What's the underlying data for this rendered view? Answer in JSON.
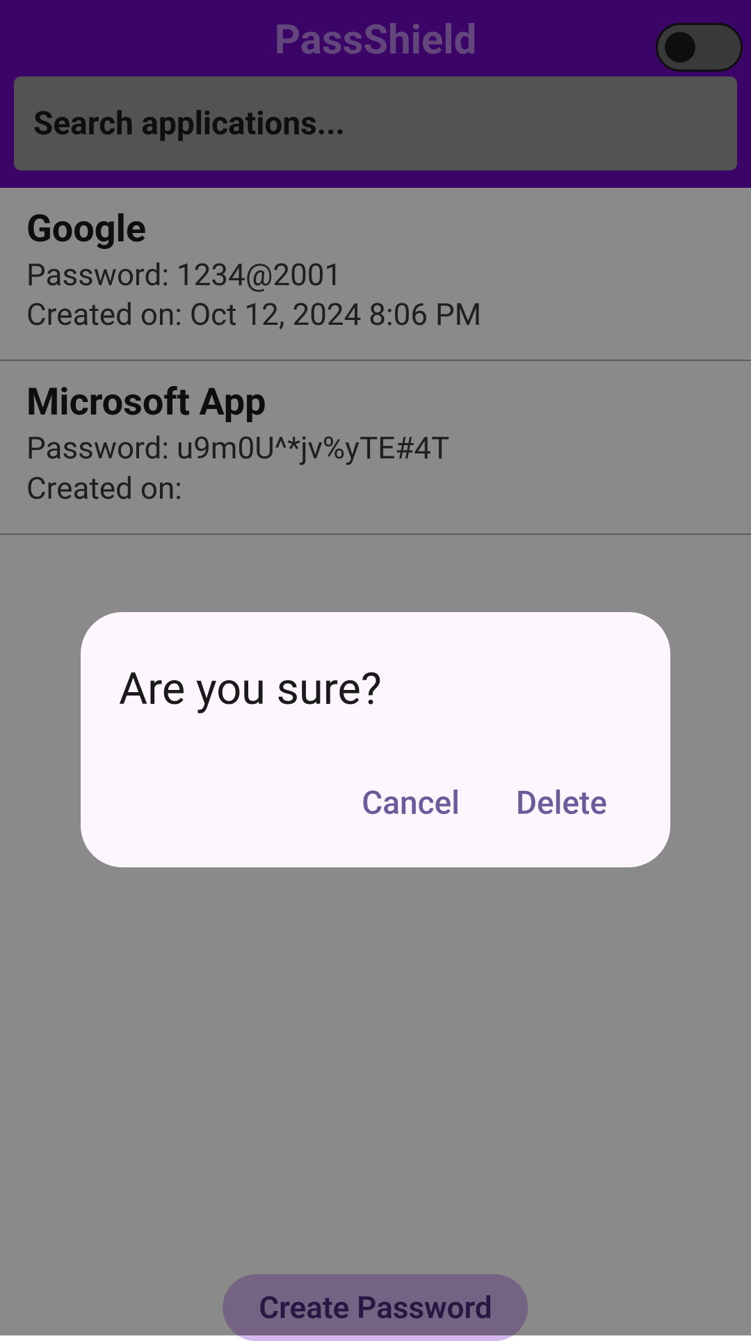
{
  "header": {
    "title": "PassShield",
    "toggle_on": false
  },
  "search": {
    "placeholder": "Search applications..."
  },
  "password_label": "Password: ",
  "created_label": "Created on: ",
  "items": [
    {
      "name": "Google",
      "password": "1234@2001",
      "created": "Oct 12, 2024 8:06 PM"
    },
    {
      "name": "Microsoft App",
      "password": "u9m0U^*jv%yTE#4T",
      "created": ""
    }
  ],
  "bottom_button": "Create Password",
  "dialog": {
    "title": "Are you sure?",
    "cancel": "Cancel",
    "delete": "Delete"
  }
}
